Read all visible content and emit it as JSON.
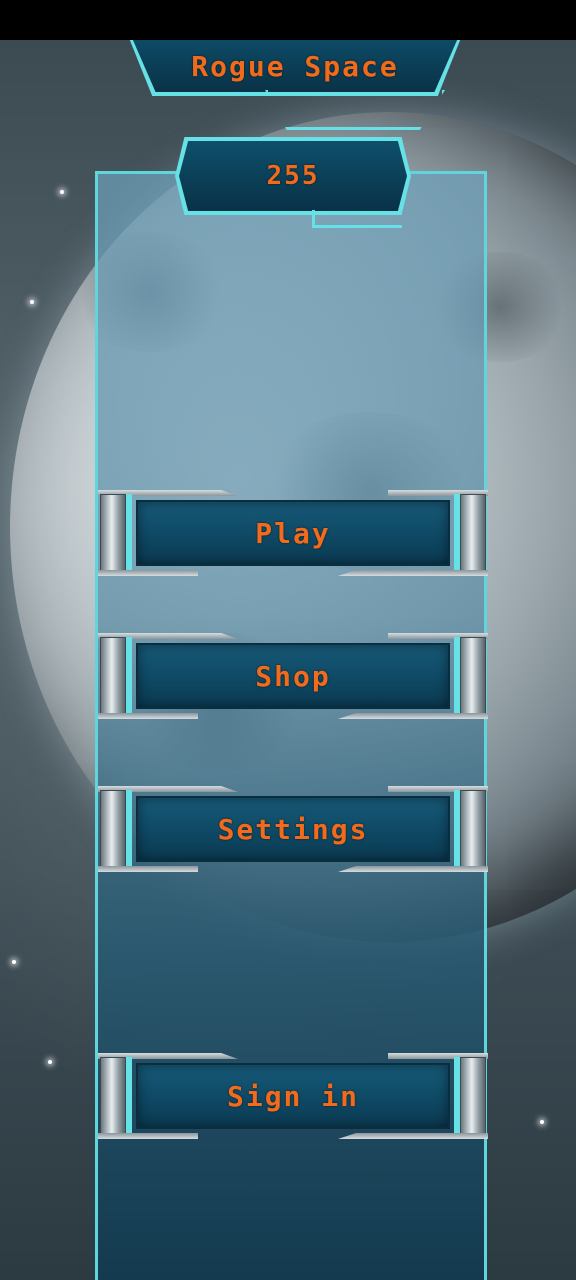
{
  "game": {
    "title": "Rogue Space",
    "score": "255"
  },
  "menu": {
    "play_label": "Play",
    "shop_label": "Shop",
    "settings_label": "Settings",
    "sign_in_label": "Sign in"
  },
  "colors": {
    "text_accent": "#f36a1b",
    "frame_accent": "#5fd6dc",
    "button_face": "#0f4a66"
  },
  "icons": {
    "background": "planet-illustration"
  }
}
